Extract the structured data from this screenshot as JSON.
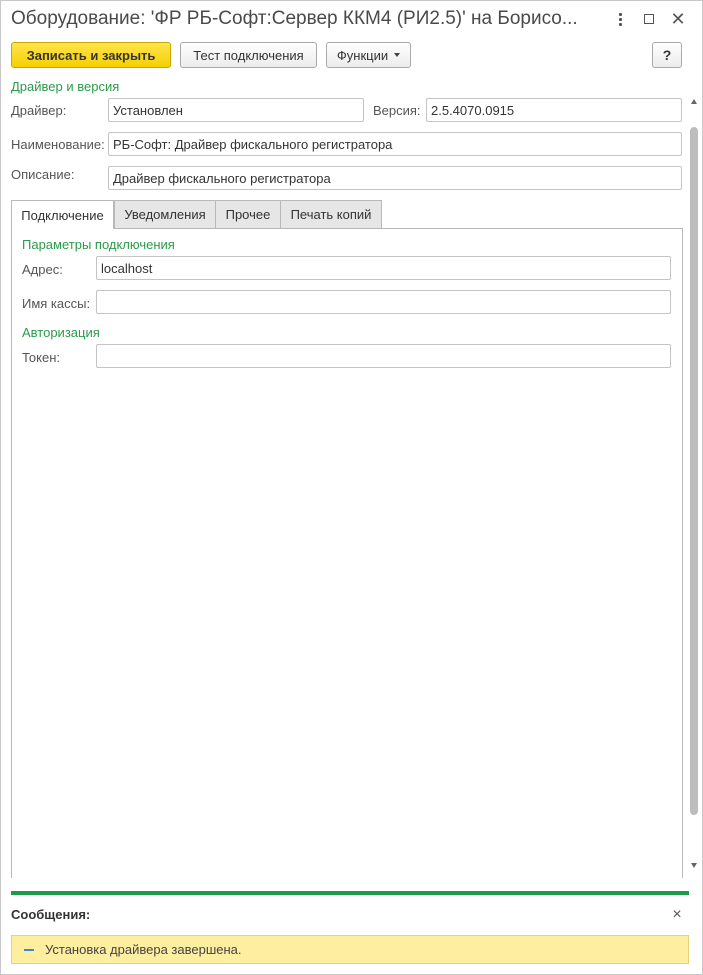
{
  "window": {
    "title": "Оборудование: 'ФР РБ-Софт:Сервер ККМ4 (РИ2.5)' на Борисо..."
  },
  "toolbar": {
    "save_close_label": "Записать и закрыть",
    "test_connection_label": "Тест подключения",
    "functions_label": "Функции",
    "help_label": "?"
  },
  "driver_group": {
    "title": "Драйвер и версия",
    "driver_label": "Драйвер:",
    "driver_value": "Установлен",
    "version_label": "Версия:",
    "version_value": "2.5.4070.0915",
    "name_label": "Наименование:",
    "name_value": "РБ-Софт: Драйвер фискального регистратора",
    "description_label": "Описание:",
    "description_value": "Драйвер фискального регистратора"
  },
  "tabs": [
    {
      "label": "Подключение",
      "active": true
    },
    {
      "label": "Уведомления",
      "active": false
    },
    {
      "label": "Прочее",
      "active": false
    },
    {
      "label": "Печать копий",
      "active": false
    }
  ],
  "connection": {
    "params_title": "Параметры подключения",
    "address_label": "Адрес:",
    "address_value": "localhost",
    "cashier_label": "Имя кассы:",
    "cashier_value": "",
    "auth_title": "Авторизация",
    "token_label": "Токен:",
    "token_value": ""
  },
  "messages": {
    "title": "Сообщения:",
    "items": [
      "Установка драйвера завершена."
    ]
  },
  "colors": {
    "accent_green": "#1d9b4a",
    "primary_button": "#f5d000",
    "message_bg": "#fdeea0"
  }
}
